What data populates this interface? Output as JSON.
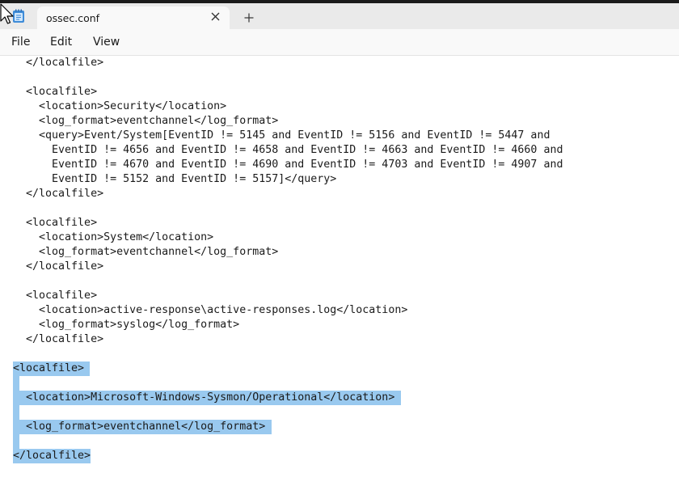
{
  "window": {
    "tab_title": "ossec.conf",
    "close_glyph": "✕",
    "new_tab_glyph": "+"
  },
  "menu": {
    "file": "File",
    "edit": "Edit",
    "view": "View"
  },
  "editor": {
    "lines": [
      "  </localfile>",
      "",
      "  <localfile>",
      "    <location>Security</location>",
      "    <log_format>eventchannel</log_format>",
      "    <query>Event/System[EventID != 5145 and EventID != 5156 and EventID != 5447 and",
      "      EventID != 4656 and EventID != 4658 and EventID != 4663 and EventID != 4660 and",
      "      EventID != 4670 and EventID != 4690 and EventID != 4703 and EventID != 4907 and",
      "      EventID != 5152 and EventID != 5157]</query>",
      "  </localfile>",
      "",
      "  <localfile>",
      "    <location>System</location>",
      "    <log_format>eventchannel</log_format>",
      "  </localfile>",
      "",
      "  <localfile>",
      "    <location>active-response\\active-responses.log</location>",
      "    <log_format>syslog</log_format>",
      "  </localfile>",
      "",
      "<localfile>",
      "",
      "  <location>Microsoft-Windows-Sysmon/Operational</location>",
      "",
      "  <log_format>eventchannel</log_format>",
      "",
      "</localfile>"
    ]
  },
  "icons": {
    "app": "notepad-icon",
    "close": "close-icon",
    "add": "plus-icon",
    "cursor": "mouse-pointer-icon"
  },
  "colors": {
    "titlebar": "#eaeaea",
    "selection": "#99c9ef",
    "editor_bg": "#ffffff"
  }
}
